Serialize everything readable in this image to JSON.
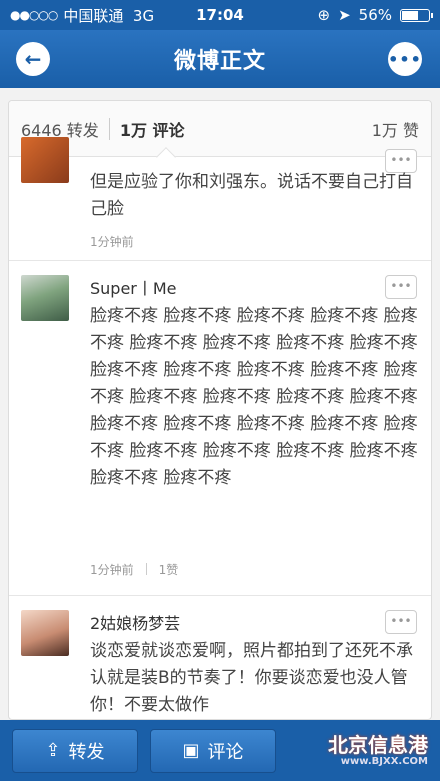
{
  "status": {
    "signal": "●●○○○",
    "carrier": "中国联通",
    "network": "3G",
    "time": "17:04",
    "battery": "56%",
    "battery_level": 0.56
  },
  "nav": {
    "title": "微博正文"
  },
  "tabs": {
    "reposts": "6446 转发",
    "comments": "1万 评论",
    "likes": "1万 赞"
  },
  "comments": [
    {
      "username": "",
      "text": "但是应验了你和刘强东。说话不要自己打自己脸",
      "time": "1分钟前",
      "likes": ""
    },
    {
      "username": "Super丨Me",
      "text": "脸疼不疼 脸疼不疼 脸疼不疼 脸疼不疼 脸疼不疼 脸疼不疼 脸疼不疼 脸疼不疼 脸疼不疼 脸疼不疼 脸疼不疼 脸疼不疼 脸疼不疼 脸疼不疼 脸疼不疼 脸疼不疼 脸疼不疼 脸疼不疼 脸疼不疼 脸疼不疼 脸疼不疼 脸疼不疼 脸疼不疼 脸疼不疼 脸疼不疼 脸疼不疼 脸疼不疼 脸疼不疼 脸疼不疼",
      "time": "1分钟前",
      "likes": "1赞"
    },
    {
      "username": "2姑娘杨梦芸",
      "text": "谈恋爱就谈恋爱啊，照片都拍到了还死不承认就是装B的节奏了！你要谈恋爱也没人管你！不要太做作",
      "time": "",
      "likes": ""
    }
  ],
  "toolbar": {
    "repost": "转发",
    "comment": "评论"
  },
  "watermark": {
    "title": "北京信息港",
    "url": "www.BJXX.COM"
  },
  "colors": {
    "brand": "#1a5fa8"
  }
}
